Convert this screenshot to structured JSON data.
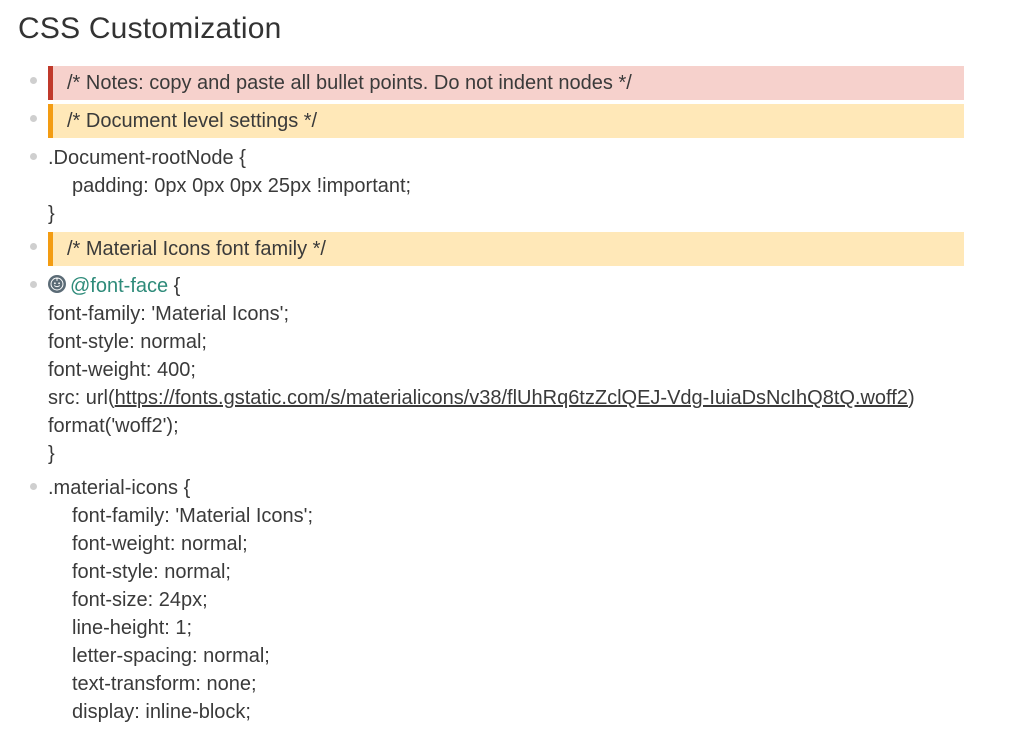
{
  "title": "CSS Customization",
  "items": [
    {
      "type": "comment-red",
      "text": "/* Notes: copy and paste all bullet points. Do not indent nodes */"
    },
    {
      "type": "comment-orange",
      "text": "/* Document level settings */"
    },
    {
      "type": "code",
      "lines": [
        ".Document-rootNode {",
        "  padding: 0px 0px 0px 25px !important;",
        "}"
      ]
    },
    {
      "type": "comment-orange",
      "text": "/* Material Icons font family */"
    },
    {
      "type": "fontface",
      "atRule": "@font-face",
      "lines_before_url": [
        "font-family: 'Material Icons';",
        "font-style: normal;",
        "font-weight: 400;"
      ],
      "src_prefix": "src: url(",
      "url": "https://fonts.gstatic.com/s/materialicons/v38/flUhRq6tzZclQEJ-Vdg-IuiaDsNcIhQ8tQ.woff2",
      "src_suffix": ") format('woff2');",
      "close": "}"
    },
    {
      "type": "code",
      "lines": [
        ".material-icons {",
        "  font-family: 'Material Icons';",
        "  font-weight: normal;",
        "  font-style: normal;",
        "  font-size: 24px;",
        "  line-height: 1;",
        "  letter-spacing: normal;",
        "  text-transform: none;",
        "  display: inline-block;"
      ]
    }
  ]
}
